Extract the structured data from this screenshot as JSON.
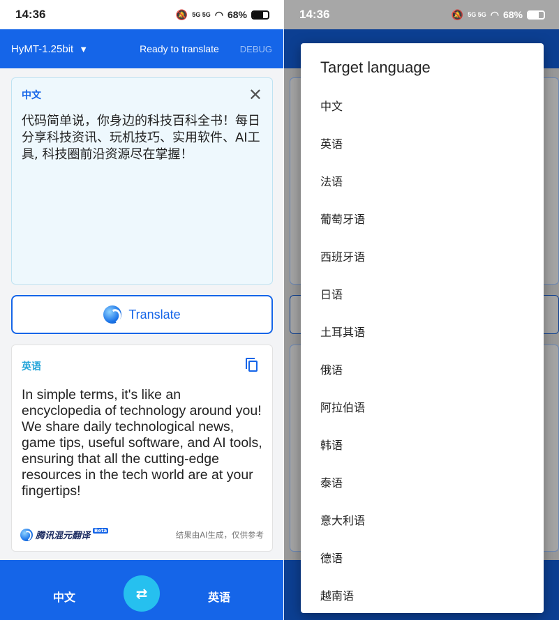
{
  "status_bar": {
    "time": "14:36",
    "signal": "5G 5G",
    "wifi_icon": "wifi-icon",
    "battery": "68%",
    "battery_level": 0.68
  },
  "app_bar": {
    "model": "HyMT-1.25bit",
    "status": "Ready to translate",
    "debug": "DEBUG"
  },
  "source": {
    "language": "中文",
    "text": "代码简单说，你身边的科技百科全书！每日分享科技资讯、玩机技巧、实用软件、AI工具, 科技圈前沿资源尽在掌握！"
  },
  "translate_button": {
    "label": "Translate"
  },
  "result": {
    "language": "英语",
    "text": "In simple terms, it's like an encyclopedia of technology around you! We share daily technological news, game tips, useful software, and AI tools, ensuring that all the cutting-edge resources in the tech world are at your fingertips!",
    "brand": "腾讯混元翻译",
    "brand_tag": "Beta",
    "disclaimer": "结果由AI生成，仅供参考"
  },
  "bottom_bar": {
    "source_lang": "中文",
    "target_lang": "英语",
    "swap_icon": "swap-arrows-icon"
  },
  "dialog": {
    "title": "Target language",
    "options": [
      "中文",
      "英语",
      "法语",
      "葡萄牙语",
      "西班牙语",
      "日语",
      "土耳其语",
      "俄语",
      "阿拉伯语",
      "韩语",
      "泰语",
      "意大利语",
      "德语",
      "越南语"
    ]
  }
}
